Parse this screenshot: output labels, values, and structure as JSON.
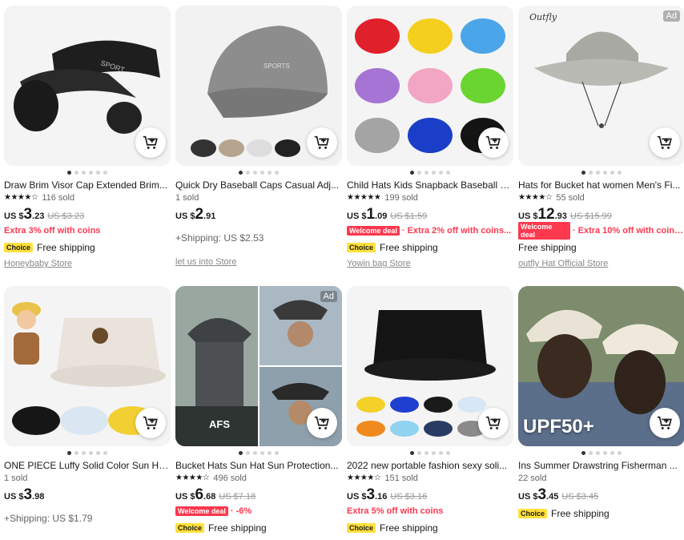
{
  "products": [
    {
      "title": "Draw Brim Visor Cap Extended Brim...",
      "rating": "★★★★☆",
      "sold": "116 sold",
      "currency": "US $",
      "price_int": "3",
      "price_dec": ".23",
      "old_price": "US $3.23",
      "extra": "Extra 3% off with coins",
      "choice": "Choice",
      "shipping": "Free shipping",
      "store": "Honeybaby Store"
    },
    {
      "title": "Quick Dry Baseball Caps Casual Adj...",
      "sold": "1 sold",
      "currency": "US $",
      "price_int": "2",
      "price_dec": ".91",
      "shipping_extra": "+Shipping: US $2.53",
      "store": "let us into Store"
    },
    {
      "title": "Child Hats Kids Snapback Baseball C...",
      "rating": "★★★★★",
      "sold": "199 sold",
      "currency": "US $",
      "price_int": "1",
      "price_dec": ".09",
      "old_price": "US $1.59",
      "welcome": "Welcome deal",
      "extra": "· Extra 2% off with coins...",
      "choice": "Choice",
      "shipping": "Free shipping",
      "store": "Yowin bag Store"
    },
    {
      "title": "Hats for Bucket hat women Men's Fi...",
      "rating": "★★★★☆",
      "sold": "55 sold",
      "currency": "US $",
      "price_int": "12",
      "price_dec": ".93",
      "old_price": "US $15.99",
      "welcome": "Welcome deal",
      "extra": "· Extra 10% off with coins...",
      "shipping": "Free shipping",
      "store": "outfly Hat Official Store",
      "brand_logo": "Outfly",
      "ad": "Ad"
    },
    {
      "title": "ONE PIECE Luffy Solid Color Sun Hat...",
      "sold": "1 sold",
      "currency": "US $",
      "price_int": "3",
      "price_dec": ".98",
      "shipping_extra": "+Shipping: US $1.79"
    },
    {
      "title": "Bucket Hats Sun Hat Sun Protection...",
      "rating": "★★★★☆",
      "sold": "496 sold",
      "currency": "US $",
      "price_int": "6",
      "price_dec": ".68",
      "old_price": "US $7.18",
      "welcome": "Welcome deal",
      "extra": "· -6%",
      "choice": "Choice",
      "shipping": "Free shipping",
      "overlay": "AFS",
      "ad": "Ad"
    },
    {
      "title": "2022 new portable fashion sexy soli...",
      "rating": "★★★★☆",
      "sold": "151 sold",
      "currency": "US $",
      "price_int": "3",
      "price_dec": ".16",
      "old_price": "US $3.16",
      "extra": "Extra 5% off with coins",
      "choice": "Choice",
      "shipping": "Free shipping"
    },
    {
      "title": "Ins Summer Drawstring Fisherman ...",
      "sold": "22 sold",
      "currency": "US $",
      "price_int": "3",
      "price_dec": ".45",
      "old_price": "US $3.45",
      "choice": "Choice",
      "shipping": "Free shipping",
      "overlay": "UPF50+"
    }
  ],
  "icons": {
    "cart": "add-to-cart-icon"
  },
  "colors": {
    "accent": "#fd384f",
    "choice": "#ffe03c",
    "text": "#191919",
    "muted": "#999999"
  }
}
